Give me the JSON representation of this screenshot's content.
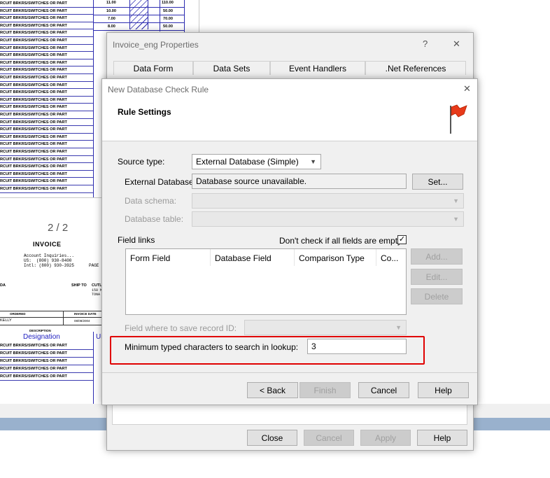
{
  "document": {
    "row_text": "RCUIT BRKRS/SWITCHES OR PART",
    "qty_values": [
      "11.00",
      "10.00",
      "7.00",
      "8.00"
    ],
    "price_values": [
      "110.00",
      "50.00",
      "70.00",
      "50.00"
    ],
    "page_indicator": "2 / 2",
    "invoice_title": "INVOICE",
    "contact_lines": "Account Inquiries...\nUS:  (800) 930-8400\nIntl: (800) 930-3925",
    "page_label": "PAGE",
    "ship_to_label": "SHIP TO",
    "ship_to_name": "CUTL",
    "ship_to_addr1": "150 M",
    "ship_to_addr2": "TONA",
    "da_label": "DA",
    "ordered_label": "ORDERED",
    "invoice_date_label": "INVOICE DATE",
    "customer_name": "KELLY",
    "invoice_date": "08/08/2004",
    "description_label": "DESCRIPTION",
    "designation_label": "Designation",
    "designation_label_2": "Ui"
  },
  "properties_dialog": {
    "title": "Invoice_eng Properties",
    "help_glyph": "?",
    "close_glyph": "✕",
    "tabs_row1": [
      "Data Form",
      "Data Sets",
      "Event Handlers",
      ".Net References"
    ],
    "buttons": {
      "close": "Close",
      "cancel": "Cancel",
      "apply": "Apply",
      "help": "Help"
    }
  },
  "rule_dialog": {
    "title": "New Database Check Rule",
    "close_glyph": "✕",
    "heading": "Rule Settings",
    "flag_icon": "red-flag-icon",
    "source_type_label": "Source type:",
    "source_type_value": "External Database (Simple)",
    "external_database_label": "External Database",
    "external_database_value": "Database source unavailable.",
    "set_button": "Set...",
    "data_schema_label": "Data schema:",
    "database_table_label": "Database table:",
    "field_links_label": "Field links",
    "dont_check_label": "Don't check if all fields are empty",
    "dont_check_checked": true,
    "checkbox_glyph": "✓",
    "columns": [
      "Form Field",
      "Database Field",
      "Comparison Type",
      "Co..."
    ],
    "add_button": "Add...",
    "edit_button": "Edit...",
    "delete_button": "Delete",
    "save_record_label": "Field where to save record ID:",
    "min_chars_label": "Minimum typed characters to search in lookup:",
    "min_chars_value": "3",
    "back_button": "< Back",
    "finish_button": "Finish",
    "cancel_button": "Cancel",
    "help_button": "Help",
    "highlight_color": "#e00000"
  }
}
